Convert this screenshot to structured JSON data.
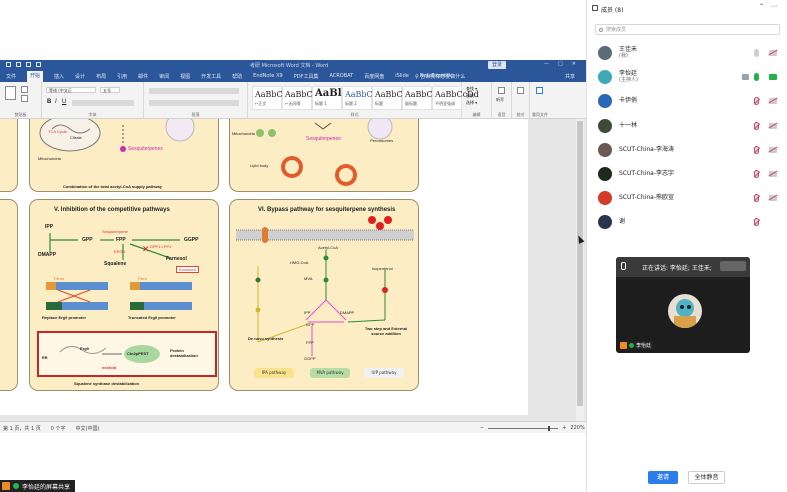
{
  "word": {
    "title": "考研 Microsoft Word 文档 - Word",
    "login_label": "登录",
    "window_controls": [
      "—",
      "□",
      "✕"
    ],
    "tabs": [
      "文件",
      "开始",
      "插入",
      "设计",
      "布局",
      "引用",
      "邮件",
      "审阅",
      "视图",
      "开发工具",
      "帮助",
      "EndNote X9",
      "PDF工具集",
      "ACROBAT",
      "百度网盘",
      "iSlide",
      "NoteExpress"
    ],
    "active_tab_index": 1,
    "tell_me": "♀ 告诉我你想要做什么",
    "share_label": "共享",
    "ribbon": {
      "font_name": "等线 (中文正",
      "font_size": "五号",
      "group_clipboard": "剪贴板",
      "group_font": "字体",
      "group_paragraph": "段落",
      "group_styles": "样式",
      "group_editing": "编辑",
      "group_voice": "语音",
      "group_review": "校对",
      "group_reuse": "重用文件",
      "styles": [
        {
          "sample": "AaBbCcDd",
          "name": "↩正文",
          "cls": ""
        },
        {
          "sample": "AaBbCcDd",
          "name": "↩无间隔",
          "cls": ""
        },
        {
          "sample": "AaBl",
          "name": "标题 1",
          "cls": "big"
        },
        {
          "sample": "AaBbC",
          "name": "标题 2",
          "cls": "h1"
        },
        {
          "sample": "AaBbC",
          "name": "标题",
          "cls": ""
        },
        {
          "sample": "AaBbC",
          "name": "副标题",
          "cls": ""
        },
        {
          "sample": "AaBbCcDd",
          "name": "不明显强调",
          "cls": ""
        }
      ],
      "side_labels": [
        "查找 ▾",
        "替换",
        "选择 ▾",
        "听写",
        "检查文档",
        "重用文件"
      ]
    },
    "status": {
      "page": "第 1 页，共 1 页",
      "words": "0 个字",
      "lang": "中文(中国)",
      "zoom": "220%"
    }
  },
  "figure": {
    "top_left": {
      "labels": [
        "TCA Cycle",
        "Citrate",
        "Mitochondria",
        "Sesquiterpenes"
      ],
      "caption": "Combination of the total acetyl-CoA supply pathway"
    },
    "top_right": {
      "labels": [
        "Mitochondria",
        "Sesquiterpenes",
        "Peroxisomes",
        "Lipid body"
      ]
    },
    "panel_v": {
      "title": "V. Inhibition of the competitive pathways",
      "labels": {
        "ipp": "IPP",
        "dmapp": "DMAPP",
        "gpp": "GPP",
        "fpp": "FPP",
        "ggpp": "GGPP",
        "sesq": "Sesquiterpene",
        "erg9": "ERG9",
        "dpp": "DPP1 LPP1",
        "squalene": "Squalene",
        "farnesol": "Farnesol",
        "knockout": "Knockout",
        "pleno": "Pleno",
        "pkex": "Pkex",
        "replace": "Replace Erg9 promoter",
        "truncated": "Truncated Erg9 promoter",
        "er": "ER",
        "erg9b": "Erg9",
        "cln": "Cln2pPEST",
        "misfold": "misfold",
        "prot_destab": "Protein destabilization",
        "caption": "Squalene synthase destabilization"
      }
    },
    "panel_vi": {
      "title": "VI. Bypass pathway for sesquiterpene synthesis",
      "labels": {
        "acetyl": "Acetyl-CoA",
        "hmg": "HMG-CoA",
        "mva": "MVA",
        "ipp": "IPP",
        "dmapp": "DMAPP",
        "gpp": "GPP",
        "fpp": "FPP",
        "ggpp": "GGPP",
        "isopentenol": "Isopentenol",
        "denovo": "De novo synthesis",
        "twostep": "Two step and External source addition",
        "legend": [
          "IPA pathway",
          "MVA pathway",
          "IUP pathway"
        ]
      }
    }
  },
  "share_indicator": "李怡廷的屏幕共享",
  "meeting": {
    "title": "成员 (8)",
    "search_placeholder": "搜索成员",
    "header_buttons": [
      "⌃",
      "⋯"
    ],
    "members": [
      {
        "name": "王佳禾",
        "sub": "(我)",
        "mic": "grey",
        "cam": "off",
        "screen": false,
        "avatar": "#5a6b7c"
      },
      {
        "name": "李怡廷",
        "sub": "(主持人)",
        "mic": "on",
        "cam": "on",
        "screen": true,
        "avatar": "#3fa9b5"
      },
      {
        "name": "卡伊俏",
        "sub": "",
        "mic": "off",
        "cam": "off",
        "screen": false,
        "avatar": "#2a67b8"
      },
      {
        "name": "十一林",
        "sub": "",
        "mic": "off",
        "cam": "off",
        "screen": false,
        "avatar": "#3d4a38"
      },
      {
        "name": "SCUT-China-李海涛",
        "sub": "",
        "mic": "off",
        "cam": "off",
        "screen": false,
        "avatar": "#6a5a52"
      },
      {
        "name": "SCUT-China-李志宇",
        "sub": "",
        "mic": "off",
        "cam": "off",
        "screen": false,
        "avatar": "#1e2a1c"
      },
      {
        "name": "SCUT-China-熊欧宣",
        "sub": "",
        "mic": "off",
        "cam": "off",
        "screen": false,
        "avatar": "#d23a2a"
      },
      {
        "name": "谢",
        "sub": "",
        "mic": "off",
        "cam": "none",
        "screen": false,
        "avatar": "#2a3550"
      }
    ],
    "speaking_label": "正在讲话: 李怡廷; 王佳禾;",
    "video_name": "李怡廷",
    "invite_label": "邀请",
    "mute_all_label": "全体静音"
  }
}
